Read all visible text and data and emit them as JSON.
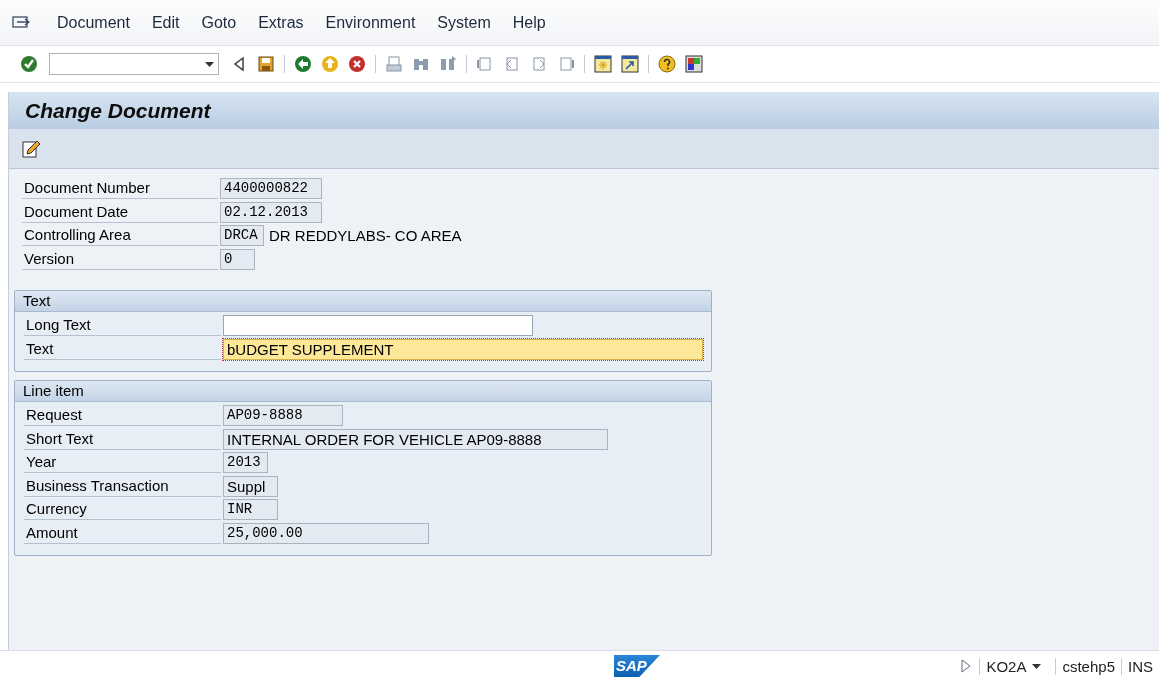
{
  "menu_bar": {
    "items": [
      "Document",
      "Edit",
      "Goto",
      "Extras",
      "Environment",
      "System",
      "Help"
    ]
  },
  "title": "Change Document",
  "header_fields": [
    {
      "label": "Document Number",
      "value": "4400000822",
      "kind": "mono",
      "editable": false
    },
    {
      "label": "Document Date",
      "value": "02.12.2013",
      "kind": "mono",
      "editable": false
    },
    {
      "label": "Controlling Area",
      "value": "DRCA",
      "kind": "mono",
      "editable": false,
      "description": "DR REDDYLABS- CO AREA"
    },
    {
      "label": "Version",
      "value": "0",
      "kind": "mono",
      "editable": false
    }
  ],
  "groups": [
    {
      "title": "Text",
      "fields": [
        {
          "label": "Long Text",
          "kind": "text",
          "editable": true,
          "focused": false
        },
        {
          "label": "Text",
          "value": "bUDGET SUPPLEMENT",
          "kind": "text",
          "editable": true,
          "focused": true
        }
      ]
    },
    {
      "title": "Line item",
      "fields": [
        {
          "label": "Request",
          "value": "AP09-8888",
          "kind": "mono",
          "editable": false
        },
        {
          "label": "Short Text",
          "value": "INTERNAL ORDER FOR VEHICLE AP09-8888",
          "kind": "text",
          "editable": false
        },
        {
          "label": "Year",
          "value": "2013",
          "kind": "mono",
          "editable": false
        },
        {
          "label": "Business Transaction",
          "value": "Suppl",
          "kind": "text",
          "editable": false
        },
        {
          "label": "Currency",
          "value": "INR",
          "kind": "mono",
          "editable": false
        },
        {
          "label": "Amount",
          "value": "25,000.00",
          "kind": "mono",
          "editable": false
        }
      ]
    }
  ],
  "status_bar": {
    "logo": "SAP",
    "transaction": "KO2A",
    "server": "cstehp5",
    "mode": "INS"
  }
}
